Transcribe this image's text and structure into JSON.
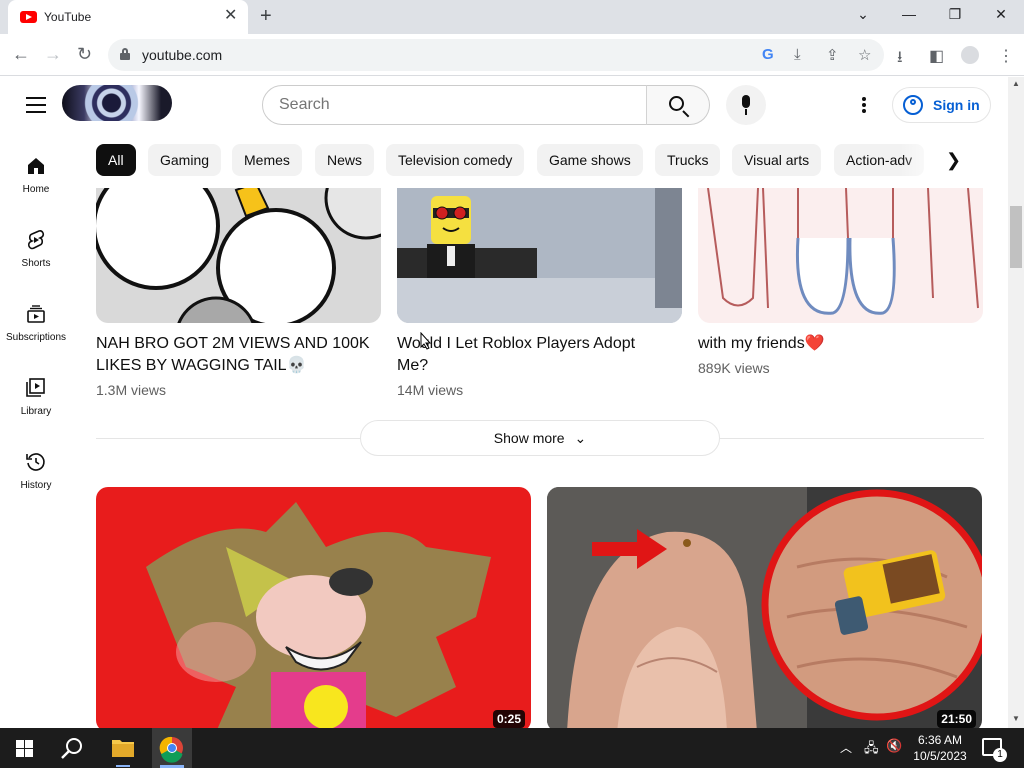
{
  "browser": {
    "tab_title": "YouTube",
    "url": "youtube.com"
  },
  "masthead": {
    "search_placeholder": "Search",
    "signin_label": "Sign in"
  },
  "chips": [
    "All",
    "Gaming",
    "Memes",
    "News",
    "Television comedy",
    "Game shows",
    "Trucks",
    "Visual arts",
    "Action-adv"
  ],
  "sidebar": {
    "items": [
      {
        "label": "Home",
        "icon": "home-icon"
      },
      {
        "label": "Shorts",
        "icon": "shorts-icon"
      },
      {
        "label": "Subscriptions",
        "icon": "subscriptions-icon"
      },
      {
        "label": "Library",
        "icon": "library-icon"
      },
      {
        "label": "History",
        "icon": "history-icon"
      }
    ]
  },
  "shorts": [
    {
      "title": "NAH BRO GOT 2M VIEWS AND 100K LIKES BY WAGGING TAIL💀",
      "views": "1.3M views"
    },
    {
      "title": "Would I Let Roblox Players Adopt Me?",
      "views": "14M views"
    },
    {
      "title": "with my friends❤️",
      "views": "889K views"
    }
  ],
  "show_more_label": "Show more",
  "videos": [
    {
      "duration": "0:25"
    },
    {
      "duration": "21:50"
    }
  ],
  "taskbar": {
    "time": "6:36 AM",
    "date": "10/5/2023"
  },
  "colors": {
    "youtube_red": "#ff0000",
    "link_blue": "#065fd4",
    "chip_bg": "#f2f2f2"
  }
}
